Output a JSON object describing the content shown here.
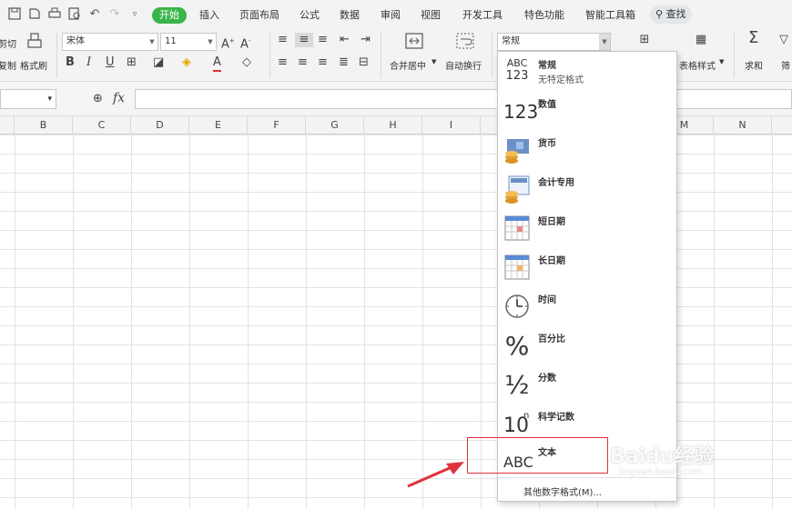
{
  "menubar": {
    "tabs": [
      "开始",
      "插入",
      "页面布局",
      "公式",
      "数据",
      "审阅",
      "视图",
      "开发工具",
      "特色功能",
      "智能工具箱"
    ],
    "search_label": "查找"
  },
  "ribbon": {
    "cut_label": "剪切",
    "copy_label": "复制",
    "format_painter_label": "格式刷",
    "font_name": "宋体",
    "font_size": "11",
    "merge_center_label": "合并居中",
    "auto_wrap_label": "自动换行",
    "number_format_value": "常规",
    "table_style_label": "表格样式",
    "sum_label": "求和",
    "filter_label": "筛"
  },
  "formula_bar": {
    "fx_label": "fx",
    "value": ""
  },
  "columns": [
    "B",
    "C",
    "D",
    "E",
    "F",
    "G",
    "H",
    "I",
    "",
    "",
    "M",
    "N"
  ],
  "number_format_menu": {
    "items": [
      {
        "label": "常规",
        "sub": "无特定格式",
        "icon": "abc-123-icon",
        "icon_text_1": "ABC",
        "icon_text_2": "123"
      },
      {
        "label": "数值",
        "sub": "",
        "icon": "number-123-icon",
        "icon_text_1": "123"
      },
      {
        "label": "货币",
        "sub": "",
        "icon": "currency-coins-icon"
      },
      {
        "label": "会计专用",
        "sub": "",
        "icon": "accounting-icon"
      },
      {
        "label": "短日期",
        "sub": "",
        "icon": "short-date-calendar-icon"
      },
      {
        "label": "长日期",
        "sub": "",
        "icon": "long-date-calendar-icon"
      },
      {
        "label": "时间",
        "sub": "",
        "icon": "clock-icon"
      },
      {
        "label": "百分比",
        "sub": "",
        "icon": "percent-icon",
        "icon_text_1": "%"
      },
      {
        "label": "分数",
        "sub": "",
        "icon": "fraction-icon",
        "icon_text_1": "½"
      },
      {
        "label": "科学记数",
        "sub": "",
        "icon": "scientific-icon",
        "icon_text_1": "10",
        "icon_text_2": "n"
      },
      {
        "label": "文本",
        "sub": "",
        "icon": "text-abc-icon",
        "icon_text_1": "ABC"
      }
    ],
    "more_label": "其他数字格式(M)..."
  },
  "watermark": {
    "text": "Baidu经验",
    "sub": "jingyan.baidu.com"
  },
  "colors": {
    "accent_green": "#39b54a",
    "highlight_red": "#e0323c",
    "arrow_red": "#e0323c"
  }
}
